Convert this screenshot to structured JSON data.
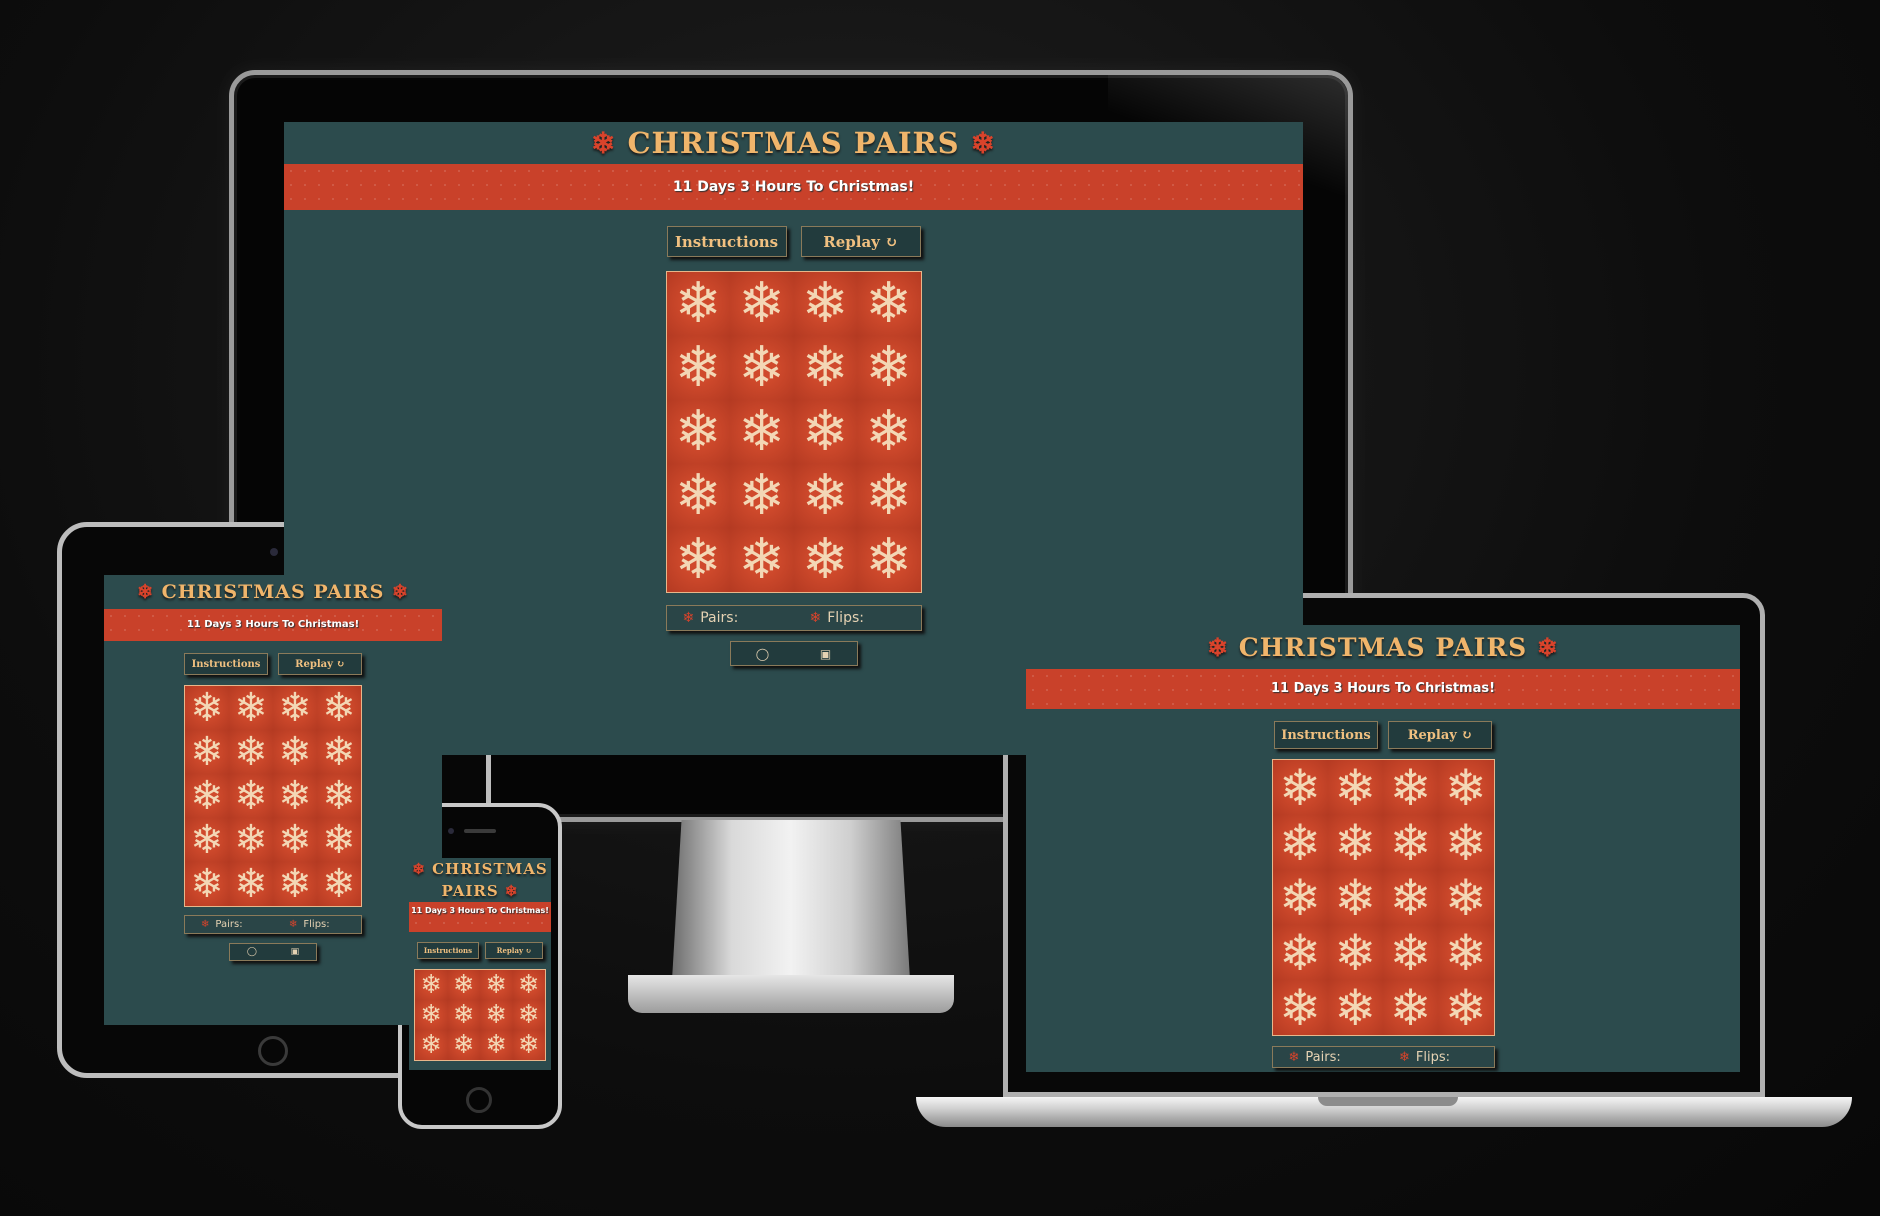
{
  "app": {
    "title": "CHRISTMAS PAIRS",
    "title_line1": "CHRISTMAS",
    "title_line2": "PAIRS",
    "flake": "❄",
    "countdown": "11 Days 3 Hours To Christmas!",
    "instructions_label": "Instructions",
    "replay_label": "Replay",
    "replay_icon": "↻",
    "card_icon": "❄",
    "pairs_label": "Pairs:",
    "flips_label": "Flips:",
    "github_icon": "◯",
    "linkedin_icon": "▣"
  },
  "colors": {
    "background": "#2c4b4d",
    "title": "#f0b56b",
    "banner": "#c9412a",
    "card": "#d04a2c",
    "flake_accent": "#d9432b"
  }
}
